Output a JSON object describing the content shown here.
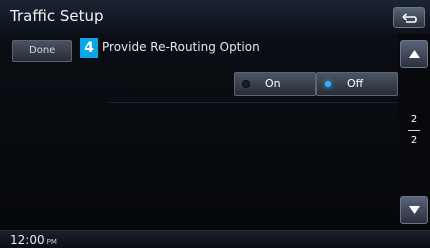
{
  "header": {
    "title": "Traffic Setup",
    "back_icon": "back-return-icon"
  },
  "content": {
    "done_label": "Done",
    "step_number": "4",
    "option_title": "Provide Re-Routing Option",
    "options": [
      {
        "label": "On",
        "selected": false
      },
      {
        "label": "Off",
        "selected": true
      }
    ],
    "selected_option": "Off"
  },
  "pagination": {
    "current": "2",
    "total": "2"
  },
  "status": {
    "time": "12:00",
    "ampm": "PM"
  },
  "colors": {
    "accent": "#34b2ff",
    "badge": "#0aa6e6"
  }
}
